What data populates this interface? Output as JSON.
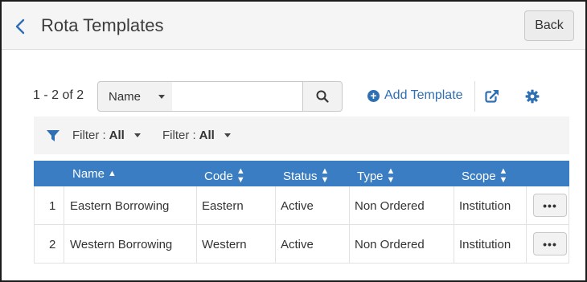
{
  "header": {
    "title": "Rota Templates",
    "back_label": "Back"
  },
  "toolbar": {
    "count": "1 - 2 of 2",
    "search_field": "Name",
    "search_value": "",
    "add_label": "Add Template"
  },
  "filters": [
    {
      "label": "Filter :",
      "value": "All"
    },
    {
      "label": "Filter :",
      "value": "All"
    }
  ],
  "table": {
    "columns": [
      {
        "label": "Name",
        "sort": "asc"
      },
      {
        "label": "Code",
        "sort": "both"
      },
      {
        "label": "Status",
        "sort": "both"
      },
      {
        "label": "Type",
        "sort": "both"
      },
      {
        "label": "Scope",
        "sort": "both"
      }
    ],
    "rows": [
      {
        "index": "1",
        "name": "Eastern Borrowing",
        "code": "Eastern",
        "status": "Active",
        "type": "Non Ordered",
        "scope": "Institution",
        "actions": "•••"
      },
      {
        "index": "2",
        "name": "Western Borrowing",
        "code": "Western",
        "status": "Active",
        "type": "Non Ordered",
        "scope": "Institution",
        "actions": "•••"
      }
    ]
  },
  "colors": {
    "accent": "#2f6fb3",
    "table_header": "#3a7dc2"
  }
}
